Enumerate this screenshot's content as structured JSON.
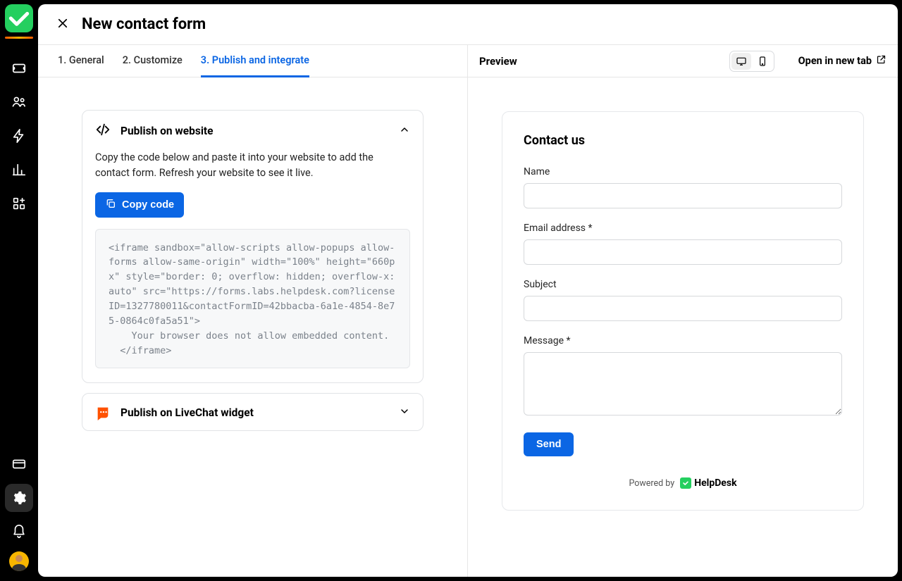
{
  "sidebar": {
    "logo": "helpdesk-logo"
  },
  "header": {
    "title": "New contact form"
  },
  "tabs": {
    "general": "1. General",
    "customize": "2. Customize",
    "publish": "3. Publish and integrate"
  },
  "publish_card": {
    "title": "Publish on website",
    "description": "Copy the code below and paste it into your website to add the contact form. Refresh your website to see it live.",
    "copy_button": "Copy code",
    "code": "<iframe sandbox=\"allow-scripts allow-popups allow-forms allow-same-origin\" width=\"100%\" height=\"660px\" style=\"border: 0; overflow: hidden; overflow-x: auto\" src=\"https://forms.labs.helpdesk.com?licenseID=1327780011&contactFormID=42bbacba-6a1e-4854-8e75-0864c0fa5a51\">\n    Your browser does not allow embedded content.\n  </iframe>"
  },
  "livechat_card": {
    "title": "Publish on LiveChat widget"
  },
  "preview": {
    "label": "Preview",
    "open_new_tab": "Open in new tab",
    "form": {
      "heading": "Contact us",
      "name_label": "Name",
      "email_label": "Email address *",
      "subject_label": "Subject",
      "message_label": "Message *",
      "send_label": "Send",
      "powered_by_text": "Powered by",
      "powered_by_brand": "HelpDesk"
    }
  }
}
